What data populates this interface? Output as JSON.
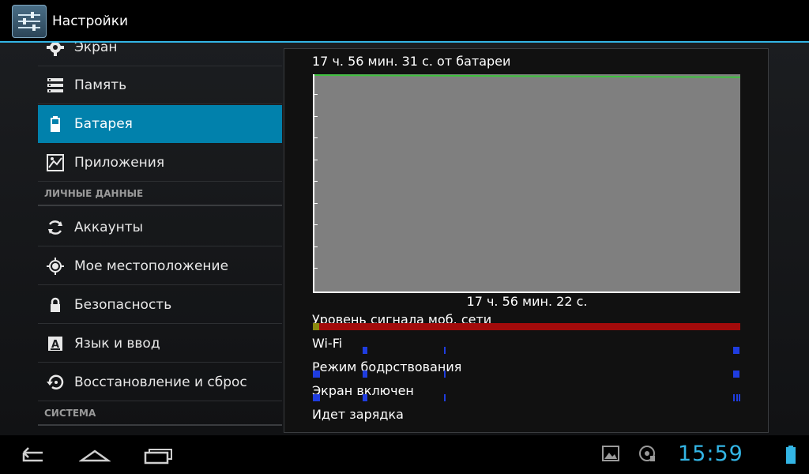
{
  "app": {
    "title": "Настройки"
  },
  "sidebar": {
    "items": [
      {
        "label": "Экран",
        "icon": "display-gear-icon"
      },
      {
        "label": "Память",
        "icon": "storage-icon"
      },
      {
        "label": "Батарея",
        "icon": "battery-icon",
        "active": true
      },
      {
        "label": "Приложения",
        "icon": "apps-icon"
      },
      {
        "label": "Аккаунты",
        "icon": "sync-icon"
      },
      {
        "label": "Мое местоположение",
        "icon": "location-icon"
      },
      {
        "label": "Безопасность",
        "icon": "lock-icon"
      },
      {
        "label": "Язык и ввод",
        "icon": "keyboard-a-icon"
      },
      {
        "label": "Восстановление и сброс",
        "icon": "restore-icon"
      }
    ],
    "sections": {
      "personal": "ЛИЧНЫЕ ДАННЫЕ",
      "system": "СИСТЕМА"
    }
  },
  "battery": {
    "on_battery_time": "17 ч. 56 мин. 31 с. от батареи",
    "graph_time_label": "17 ч. 56 мин. 22 с.",
    "graph_level_start_percent": 100,
    "graph_level_end_percent": 99,
    "rows": {
      "signal": "Уровень сигнала моб. сети",
      "wifi": "Wi-Fi",
      "awake": "Режим бодрствования",
      "screen_on": "Экран включен",
      "charging": "Идет зарядка"
    },
    "colors": {
      "graph_bg": "#7f7f7f",
      "graph_line": "#3ec33e",
      "signal": "#a30b0b",
      "activity": "#1f3de0"
    }
  },
  "navbar": {
    "clock": "15:59"
  },
  "colors": {
    "accent": "#33b5e5",
    "active_item": "#0181ac"
  }
}
